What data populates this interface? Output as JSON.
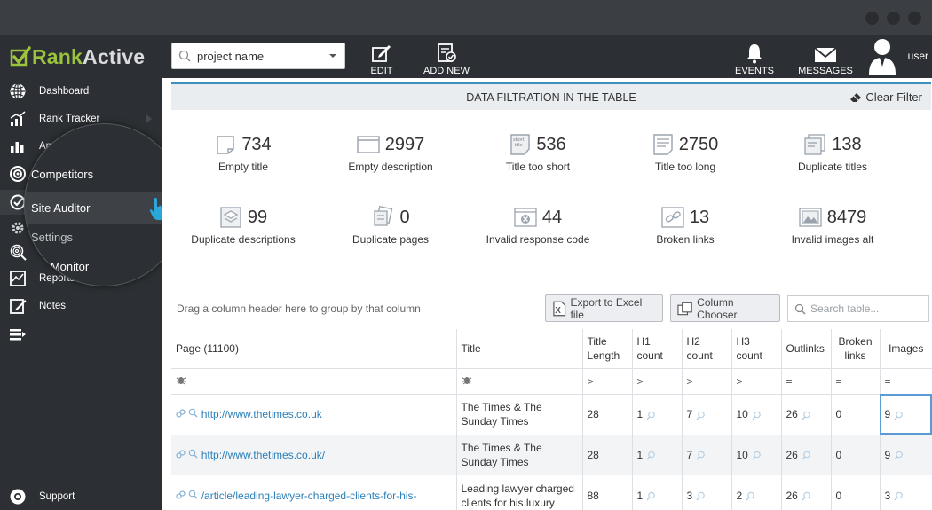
{
  "app": {
    "brand_prefix": "Rank",
    "brand_suffix": "Active",
    "colors": {
      "accent": "#3d8fbc",
      "brand_green": "#9cc33c",
      "sidebar": "#2c2f33",
      "link": "#2c7fb8",
      "highlight": "#2aa7d8"
    }
  },
  "topbar": {
    "project_select_value": "project name",
    "buttons": {
      "edit": "EDIT",
      "add_new": "ADD NEW",
      "events": "EVENTS",
      "messages": "MESSAGES"
    },
    "user": "user"
  },
  "sidebar": {
    "items": [
      {
        "label": "Dashboard",
        "icon": "globe-icon"
      },
      {
        "label": "Rank Tracker",
        "icon": "rank-chart-icon"
      },
      {
        "label": "Analytics",
        "icon": "bar-chart-icon"
      },
      {
        "label": "Competitors",
        "icon": "target-icon"
      },
      {
        "label": "Site Auditor",
        "icon": "auditor-icon"
      },
      {
        "label": "Settings",
        "icon": "gear-icon"
      },
      {
        "label": "Brand Monitor",
        "icon": "fingerprint-icon"
      },
      {
        "label": "Reports",
        "icon": "report-icon"
      },
      {
        "label": "Notes",
        "icon": "notes-icon"
      },
      {
        "label": "",
        "icon": "list-icon"
      },
      {
        "label": "Support",
        "icon": "support-icon"
      }
    ],
    "visible_labels": {
      "rank_tracker": "Rank Tracker",
      "analytics_partial": "An    ics",
      "reports": "Reports",
      "support": "Support",
      "dashboard": "Dashboard",
      "notes": "Notes"
    },
    "magnifier": {
      "competitors": "Competitors",
      "site_auditor": "Site Auditor",
      "settings": "Settings",
      "monitor": "d Monitor"
    }
  },
  "filter": {
    "title": "DATA FILTRATION IN THE TABLE",
    "clear": "Clear Filter"
  },
  "stats": [
    {
      "value": "734",
      "label": "Empty title"
    },
    {
      "value": "2997",
      "label": "Empty description"
    },
    {
      "value": "536",
      "label": "Title too short"
    },
    {
      "value": "2750",
      "label": "Title too long"
    },
    {
      "value": "138",
      "label": "Duplicate titles"
    },
    {
      "value": "99",
      "label": "Duplicate descriptions"
    },
    {
      "value": "0",
      "label": "Duplicate pages"
    },
    {
      "value": "44",
      "label": "Invalid response code"
    },
    {
      "value": "13",
      "label": "Broken links"
    },
    {
      "value": "8479",
      "label": "Invalid images alt"
    }
  ],
  "toolbar": {
    "group_hint": "Drag a column header here to group by that column",
    "export": "Export to Excel file",
    "column_chooser": "Column Chooser",
    "search_placeholder": "Search table..."
  },
  "table": {
    "headers": {
      "page": "Page (11100)",
      "title": "Title",
      "title_length_1": "Title",
      "title_length_2": "Length",
      "h1_1": "H1",
      "h1_2": "count",
      "h2_1": "H2",
      "h2_2": "count",
      "h3_1": "H3",
      "h3_2": "count",
      "outlinks": "Outlinks",
      "broken_1": "Broken",
      "broken_2": "links",
      "images": "Images"
    },
    "filter_ops": {
      "gt": ">",
      "eq": "="
    },
    "rows": [
      {
        "page": "http://www.thetimes.co.uk",
        "title_1": "The Times & The",
        "title_2": "Sunday Times",
        "title_length": "28",
        "h1": "1",
        "h2": "7",
        "h3": "10",
        "outlinks": "26",
        "broken": "0",
        "images": "9"
      },
      {
        "page": "http://www.thetimes.co.uk/",
        "title_1": "The Times & The",
        "title_2": "Sunday Times",
        "title_length": "28",
        "h1": "1",
        "h2": "7",
        "h3": "10",
        "outlinks": "26",
        "broken": "0",
        "images": "9"
      },
      {
        "page": "/article/leading-lawyer-charged-clients-for-his-",
        "title_1": "Leading lawyer charged",
        "title_2": "clients for his luxury",
        "title_length": "88",
        "h1": "1",
        "h2": "3",
        "h3": "2",
        "outlinks": "26",
        "broken": "0",
        "images": "3"
      }
    ]
  }
}
